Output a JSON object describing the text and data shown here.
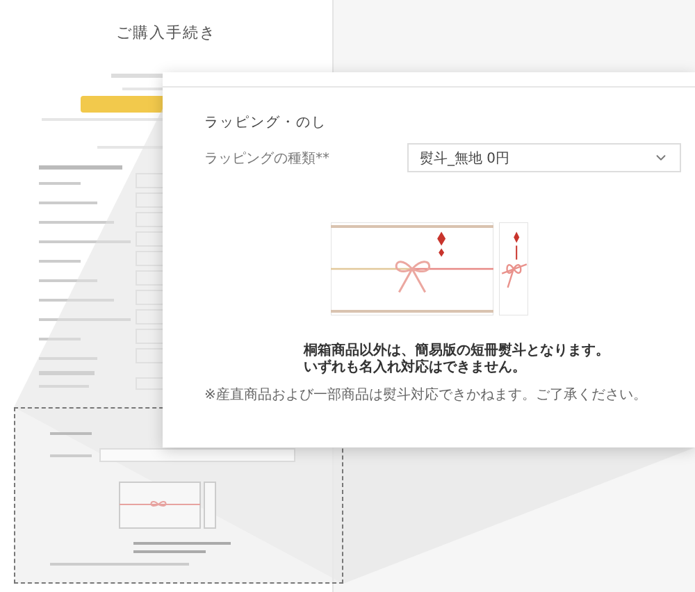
{
  "page": {
    "title": "ご購入手続き"
  },
  "panel": {
    "heading": "ラッピング・のし",
    "field": {
      "label": "ラッピングの種類**",
      "value": "熨斗_無地 0円"
    },
    "message": [
      "桐箱商品以外は、簡易版の短冊熨斗となります。",
      "いずれも名入れ対応はできません。"
    ],
    "note": "※産直商品および一部商品は熨斗対応できかねます。ご了承ください。"
  }
}
